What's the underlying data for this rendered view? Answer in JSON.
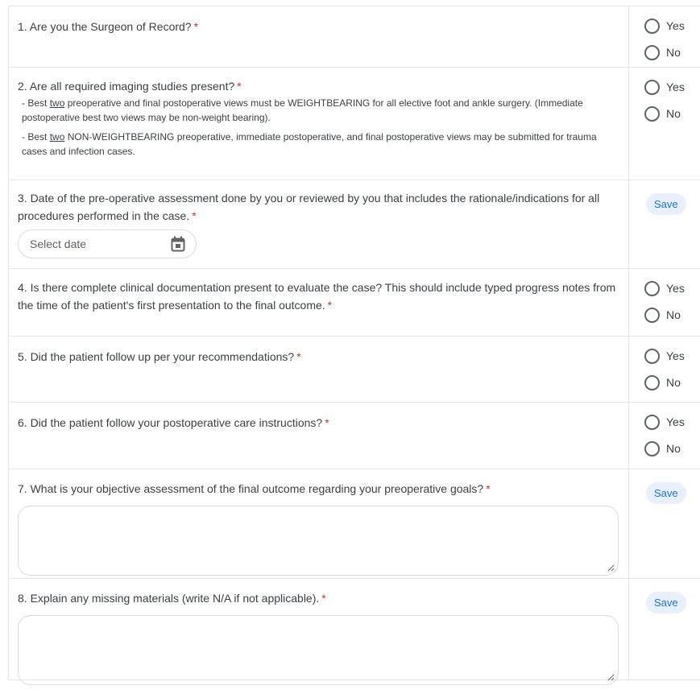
{
  "required_marker": "*",
  "questions": [
    {
      "text": "1. Are you the Surgeon of Record?",
      "options": [
        "Yes",
        "No"
      ]
    },
    {
      "text": "2. Are all required imaging studies present?",
      "notes": [
        {
          "before": "- Best ",
          "underlined": "two",
          "after": " preoperative and final postoperative views must be WEIGHTBEARING for all elective foot and ankle surgery. (Immediate postoperative best two views may be non-weight bearing)."
        },
        {
          "before": "- Best ",
          "underlined": "two",
          "after": " NON-WEIGHTBEARING preoperative, immediate postoperative, and final postoperative views may be submitted for trauma cases and infection cases."
        }
      ],
      "options": [
        "Yes",
        "No"
      ]
    },
    {
      "text": "3. Date of the pre-operative assessment done by you or reviewed by you that includes the rationale/indications for all procedures performed in the case.",
      "date_placeholder": "Select date",
      "calendar_icon": "calendar-icon",
      "save_label": "Save"
    },
    {
      "text": "4. Is there complete clinical documentation present to evaluate the case? This should include typed progress notes from the time of the patient's first presentation to the final outcome.",
      "options": [
        "Yes",
        "No"
      ]
    },
    {
      "text": "5. Did the patient follow up per your recommendations?",
      "options": [
        "Yes",
        "No"
      ]
    },
    {
      "text": "6. Did the patient follow your postoperative care instructions?",
      "options": [
        "Yes",
        "No"
      ]
    },
    {
      "text": "7. What is your objective assessment of the final outcome regarding your preoperative goals?",
      "textarea_value": "",
      "save_label": "Save"
    },
    {
      "text": "8. Explain any missing materials (write N/A if not applicable).",
      "textarea_value": "",
      "save_label": "Save"
    }
  ],
  "colors": {
    "required": "#d93025",
    "save_bg": "#e8f0fe",
    "save_text": "#1a73e8",
    "border": "#e3e6ea"
  }
}
